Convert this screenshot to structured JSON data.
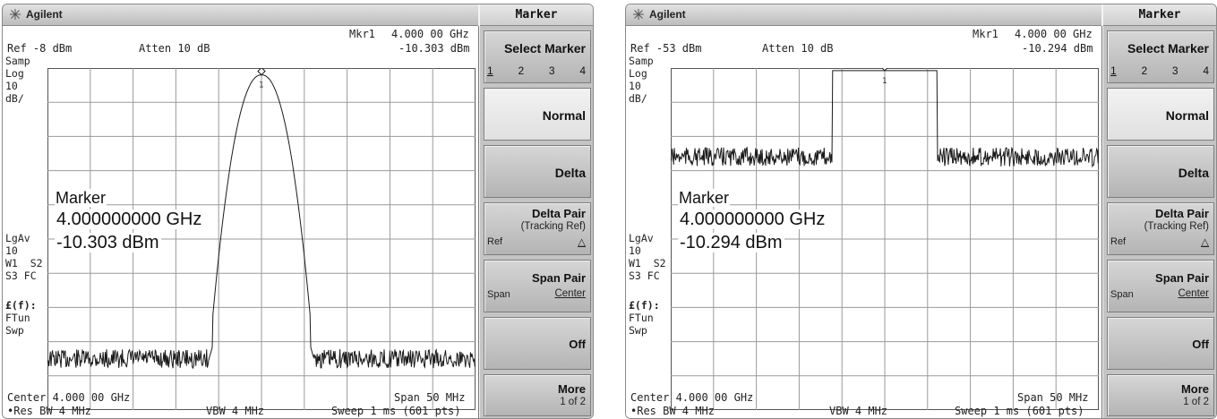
{
  "panels": [
    {
      "brand": "Agilent",
      "marker_readout": {
        "label": "Mkr1",
        "freq": "4.000 00 GHz",
        "amp": "-10.303 dBm"
      },
      "header": {
        "ref": "Ref -8 dBm",
        "atten": "Atten 10 dB"
      },
      "left_labels": {
        "samp": "Samp",
        "log": "Log",
        "scale": "10",
        "units": "dB/",
        "lgav": "LgAv",
        "lgav_val": "10",
        "w1s2": "W1  S2",
        "s3fc": "S3 FC",
        "lf": "£(f):",
        "ftun": "FTun",
        "swp": "Swp"
      },
      "big_readout": {
        "title": "Marker",
        "freq": "4.000000000 GHz",
        "amp": "-10.303 dBm"
      },
      "marker_number": "1",
      "footer": {
        "center": "Center 4.000 00 GHz",
        "span": "Span 50 MHz",
        "rbw": "•Res BW 4 MHz",
        "vbw": "VBW 4 MHz",
        "sweep": "Sweep 1 ms (601 pts)"
      }
    },
    {
      "brand": "Agilent",
      "marker_readout": {
        "label": "Mkr1",
        "freq": "4.000 00 GHz",
        "amp": "-10.294 dBm"
      },
      "header": {
        "ref": "Ref -53 dBm",
        "atten": "Atten 10 dB"
      },
      "left_labels": {
        "samp": "Samp",
        "log": "Log",
        "scale": "10",
        "units": "dB/",
        "lgav": "LgAv",
        "lgav_val": "10",
        "w1s2": "W1  S2",
        "s3fc": "S3 FC",
        "lf": "£(f):",
        "ftun": "FTun",
        "swp": "Swp"
      },
      "big_readout": {
        "title": "Marker",
        "freq": "4.000000000 GHz",
        "amp": "-10.294 dBm"
      },
      "marker_number": "1",
      "footer": {
        "center": "Center 4.000 00 GHz",
        "span": "Span 50 MHz",
        "rbw": "•Res BW 4 MHz",
        "vbw": "VBW 4 MHz",
        "sweep": "Sweep 1 ms (601 pts)"
      }
    }
  ],
  "softkeys": {
    "title": "Marker",
    "select_marker": {
      "label": "Select Marker",
      "options": [
        "1",
        "2",
        "3",
        "4"
      ],
      "selected": "1"
    },
    "normal": "Normal",
    "delta": "Delta",
    "delta_pair": {
      "label": "Delta Pair",
      "sub": "(Tracking Ref)",
      "left": "Ref",
      "right": "△"
    },
    "span_pair": {
      "label": "Span Pair",
      "left": "Span",
      "right": "Center"
    },
    "off": "Off",
    "more": {
      "label": "More",
      "sub": "1 of 2"
    }
  },
  "colors": {
    "trace": "#1a1a1a",
    "grid": "#9a9a9a",
    "softkey_bg": "#c4c4c4",
    "screen_bg": "#ffffff"
  },
  "traces": [
    {
      "shape": "bell",
      "noise_floor_div": 8.5,
      "peak_div": 0.2
    },
    {
      "shape": "rect",
      "noise_floor_div": 2.6,
      "plateau_div": 0.05
    }
  ]
}
